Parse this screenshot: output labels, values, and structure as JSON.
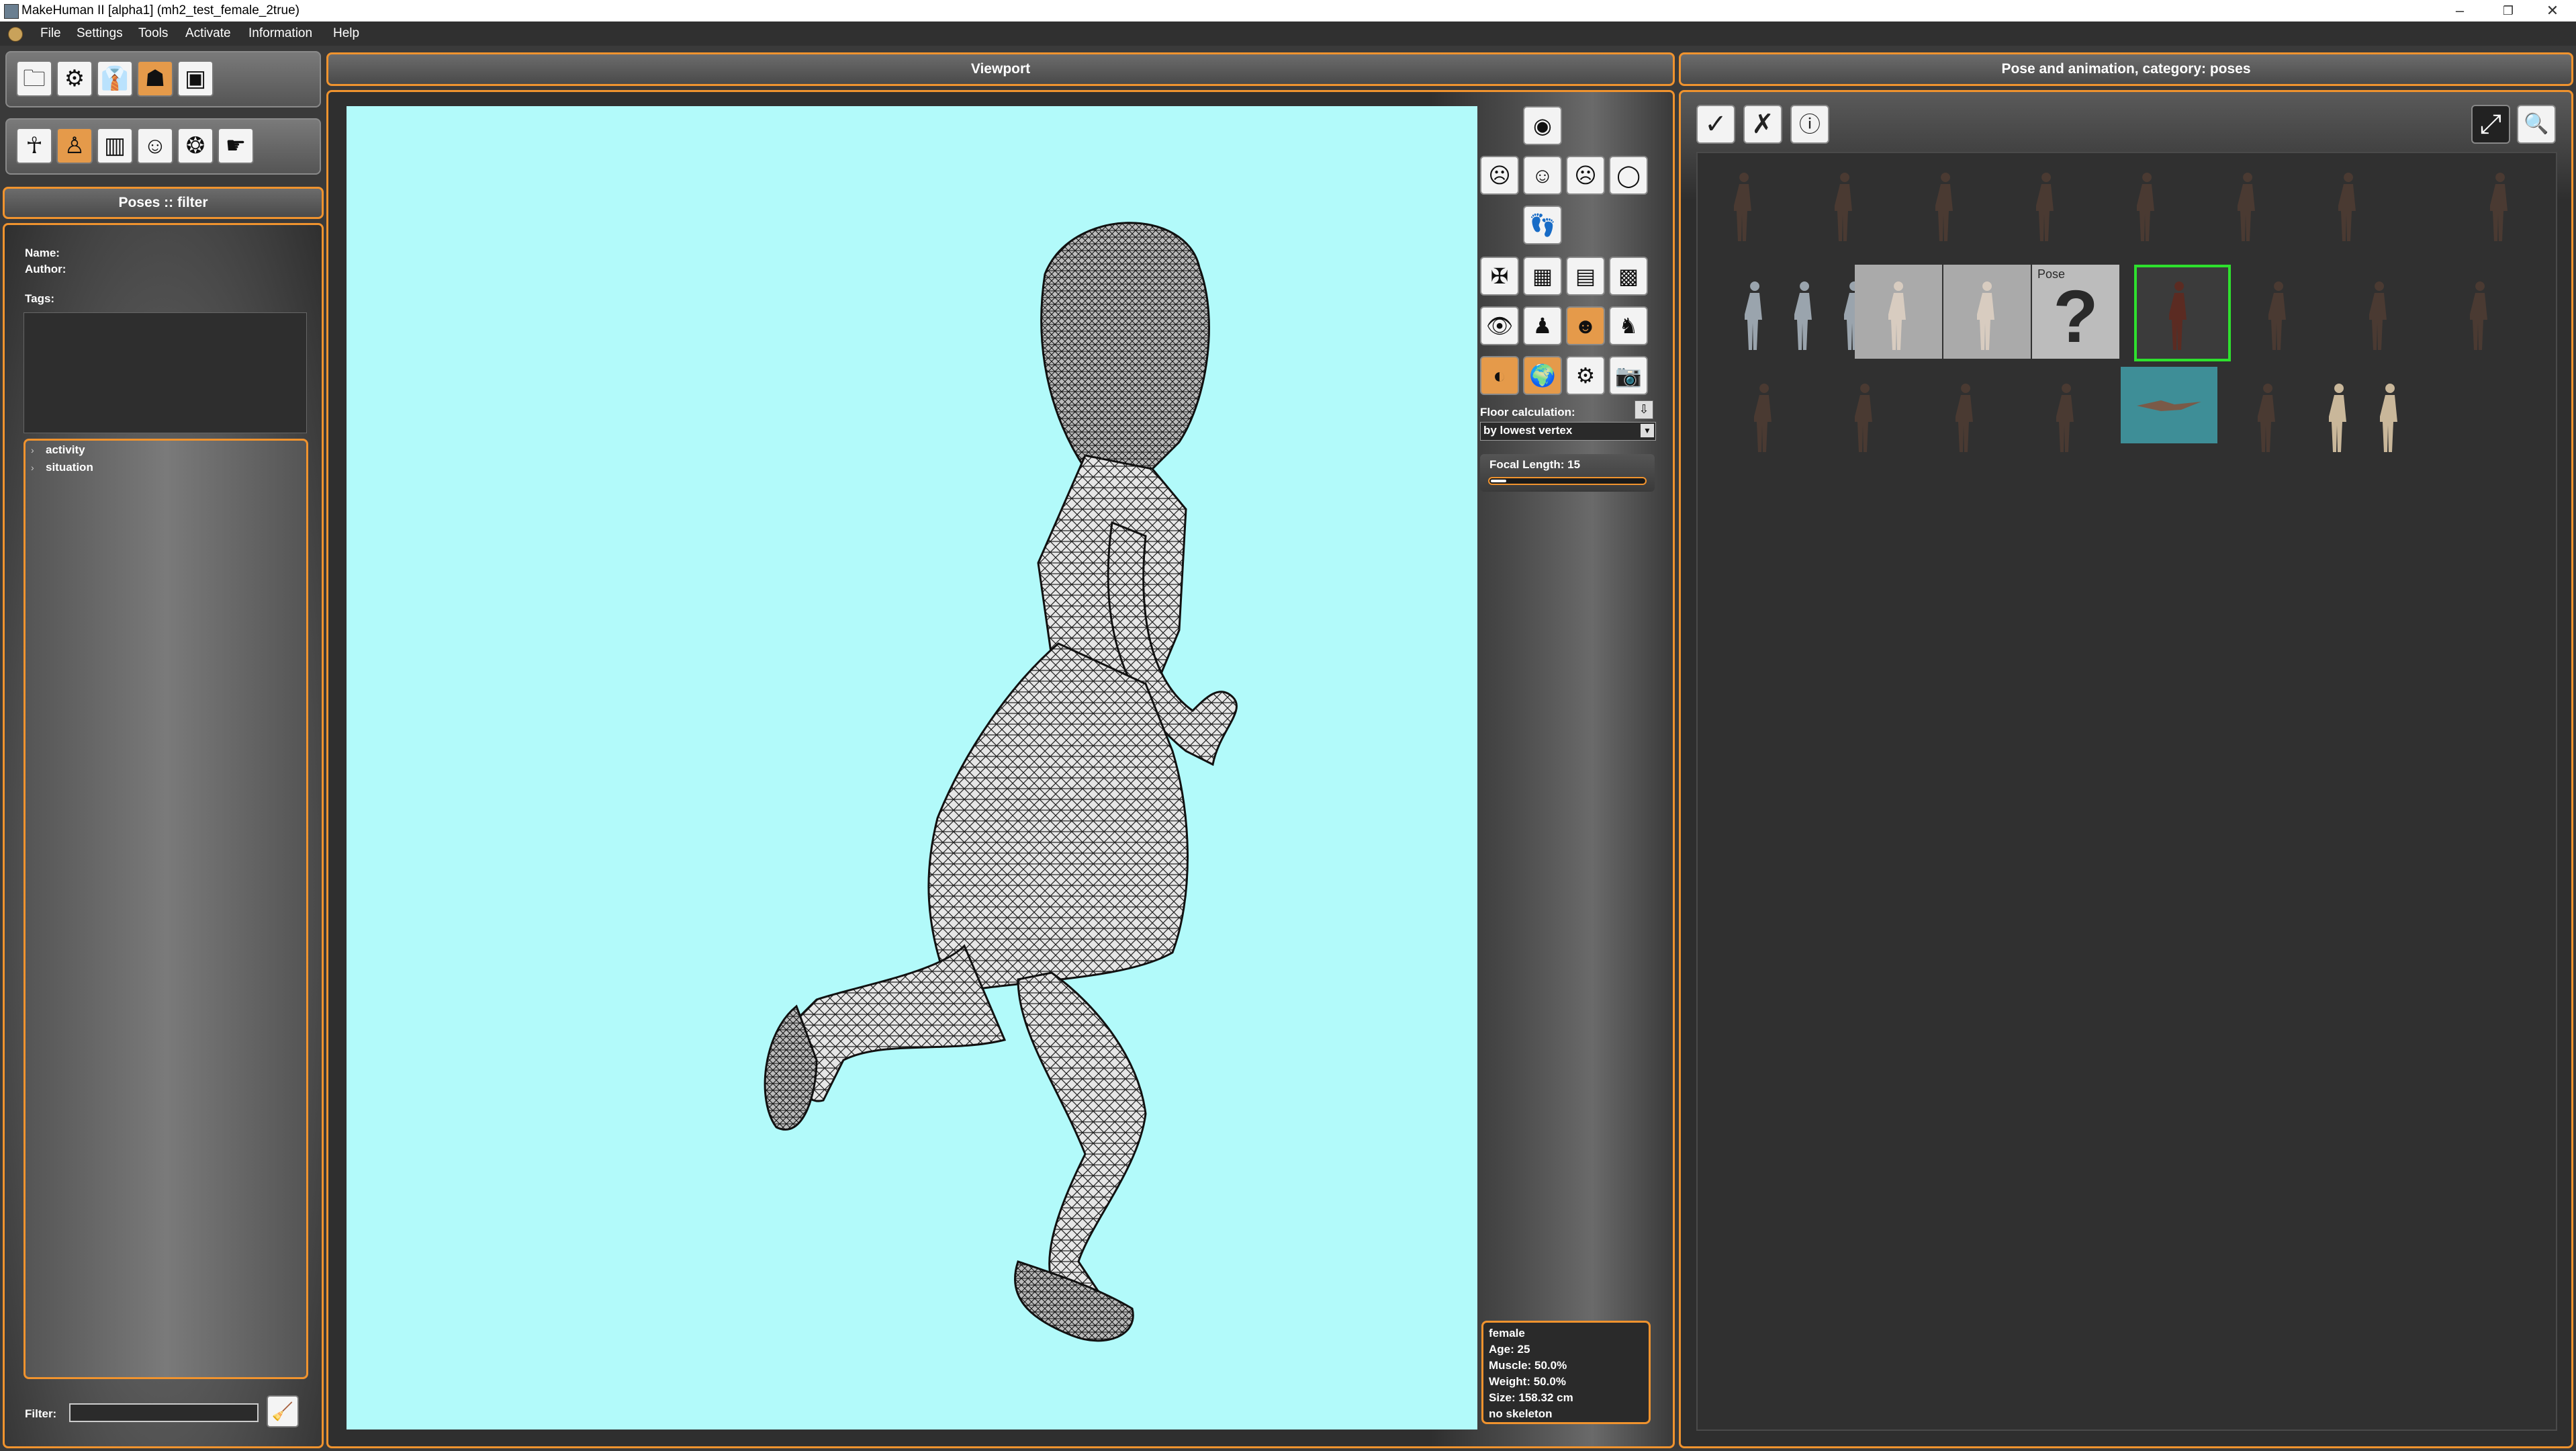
{
  "window": {
    "title": "MakeHuman II [alpha1]  (mh2_test_female_2true)",
    "minimize": "–",
    "maximize": "❐",
    "close": "✕"
  },
  "menu": [
    "File",
    "Settings",
    "Tools",
    "Activate",
    "Information",
    "Help"
  ],
  "left": {
    "filter_header": "Poses :: filter",
    "name_label": "Name:",
    "author_label": "Author:",
    "tags_label": "Tags:",
    "tree": [
      "activity",
      "situation"
    ],
    "filter_label": "Filter:",
    "filter_value": ""
  },
  "viewport": {
    "header": "Viewport",
    "floor_label": "Floor calculation:",
    "floor_value": "by lowest vertex",
    "focal_label": "Focal Length: 15",
    "focal_fraction": 0.1,
    "background_color": "#b2fafa",
    "info": [
      "female",
      "Age: 25",
      "Muscle: 50.0%",
      "Weight: 50.0%",
      "Size: 158.32 cm",
      "no skeleton"
    ]
  },
  "right": {
    "header": "Pose and animation, category: poses",
    "unknown_pose_label": "Pose",
    "unknown_pose_mark": "?"
  },
  "colors": {
    "accent": "#f0932e",
    "selection": "#2ee02e"
  }
}
